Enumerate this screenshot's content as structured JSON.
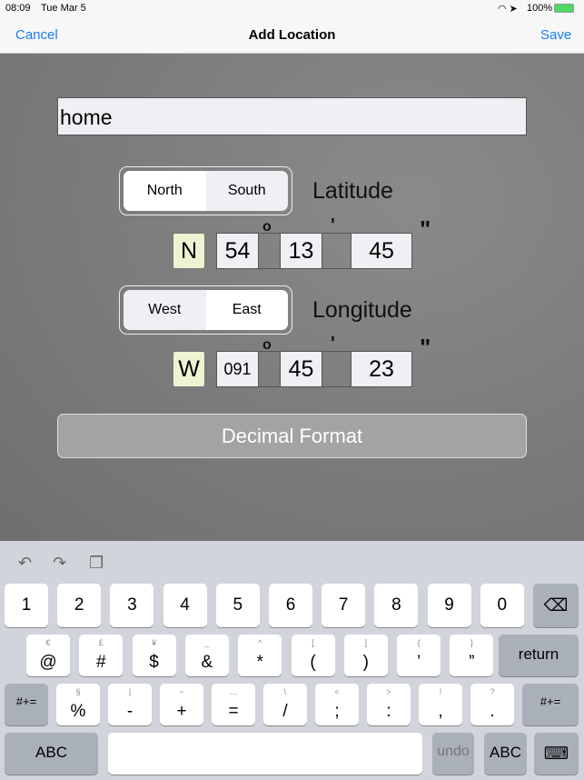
{
  "status": {
    "time": "08:09",
    "date": "Tue Mar 5",
    "battery": "100%"
  },
  "nav": {
    "cancel": "Cancel",
    "title": "Add Location",
    "save": "Save"
  },
  "form": {
    "name_value": "home",
    "lat_segment": {
      "options": [
        "North",
        "South"
      ],
      "selected": "North"
    },
    "lat_label": "Latitude",
    "lat_hemi": "N",
    "lat_deg": "54",
    "lat_min": "13",
    "lat_sec": "45",
    "lon_segment": {
      "options": [
        "West",
        "East"
      ],
      "selected": "East"
    },
    "lon_label": "Longitude",
    "lon_hemi": "W",
    "lon_deg": "091",
    "lon_min": "45",
    "lon_sec": "23",
    "deg_mark": "o",
    "min_mark": "'",
    "sec_mark": "\"",
    "decimal_button": "Decimal Format"
  },
  "keyboard": {
    "toolbar": [
      "undo-icon",
      "redo-icon",
      "paste-icon"
    ],
    "row1": [
      "1",
      "2",
      "3",
      "4",
      "5",
      "6",
      "7",
      "8",
      "9",
      "0"
    ],
    "row2": [
      [
        "@",
        "€"
      ],
      [
        "#",
        "£"
      ],
      [
        "$",
        "¥"
      ],
      [
        "&",
        "_"
      ],
      [
        "*",
        "^"
      ],
      [
        "(",
        "["
      ],
      [
        ")",
        "]"
      ],
      [
        "’",
        "{"
      ],
      [
        "”",
        "}"
      ]
    ],
    "return": "return",
    "row3": [
      [
        "%",
        "§"
      ],
      [
        "-",
        "|"
      ],
      [
        "+",
        "~"
      ],
      [
        "=",
        "…"
      ],
      [
        "/",
        "\\"
      ],
      [
        ";",
        "<"
      ],
      [
        ":",
        ">"
      ],
      [
        ",",
        "!"
      ],
      [
        ".",
        "?"
      ]
    ],
    "shift": "#+=",
    "abc": "ABC",
    "undo": "undo"
  }
}
